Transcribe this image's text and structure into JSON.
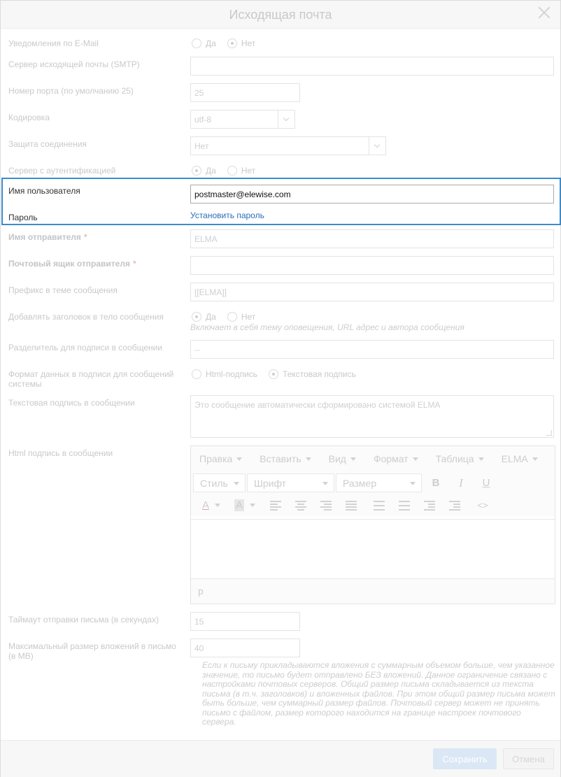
{
  "dialog": {
    "title": "Исходящая почта",
    "close_icon": "close-icon"
  },
  "fields": {
    "email_notifications": {
      "label": "Уведомления по E-Mail",
      "options": [
        "Да",
        "Нет"
      ],
      "selected": "Нет"
    },
    "smtp_server": {
      "label": "Сервер исходящей почты (SMTP)",
      "value": ""
    },
    "port": {
      "label": "Номер порта (по умолчанию 25)",
      "value": "25"
    },
    "encoding": {
      "label": "Кодировка",
      "value": "utf-8"
    },
    "security": {
      "label": "Защита соединения",
      "value": "Нет"
    },
    "auth_server": {
      "label": "Сервер с аутентификацией",
      "options": [
        "Да",
        "Нет"
      ],
      "selected": "Да"
    },
    "username": {
      "label": "Имя пользователя",
      "value": "postmaster@elewise.com"
    },
    "password": {
      "label": "Пароль",
      "link": "Установить пароль"
    },
    "sender_name": {
      "label": "Имя отправителя",
      "required": "*",
      "value": "ELMA"
    },
    "sender_mailbox": {
      "label": "Почтовый ящик отправителя",
      "required": "*",
      "value": ""
    },
    "subject_prefix": {
      "label": "Префикс в теме сообщения",
      "value": "[[ELMA]]"
    },
    "add_header": {
      "label": "Добавлять заголовок в тело сообщения",
      "options": [
        "Да",
        "Нет"
      ],
      "selected": "Да",
      "hint": "Включает в себя тему оповещения, URL адрес и автора сообщения"
    },
    "signature_separator": {
      "label": "Разделитель для подписи в сообщении",
      "value": "--"
    },
    "signature_format": {
      "label": "Формат данных в подписи для сообщений системы",
      "options": [
        "Html-подпись",
        "Текстовая подпись"
      ],
      "selected": "Текстовая подпись"
    },
    "text_signature": {
      "label": "Текстовая подпись в сообщении",
      "value": "Это сообщение автоматически сформировано системой ELMA"
    },
    "html_signature": {
      "label": "Html подпись в сообщении"
    },
    "send_timeout": {
      "label": "Таймаут отправки письма (в секундах)",
      "value": "15"
    },
    "max_attachment": {
      "label": "Максимальный размер вложений в письмо (в МВ)",
      "value": "40",
      "info": "Если к письму прикладываются вложения с суммарным объемом больше, чем указанное значение, то письмо будет отправлено БЕЗ вложений. Данное ограничение связано с настройками почтовых серверов. Общий размер письма складывается из текста письма (в т.ч. заголовков) и вложенных файлов. При этом общий размер письма может быть больше, чем суммарный размер файлов. Почтовый сервер может не принять письмо с файлом, размер которого находится на границе настроек почтового сервера."
    }
  },
  "editor": {
    "menus": [
      "Правка",
      "Вставить",
      "Вид",
      "Формат",
      "Таблица",
      "ELMA"
    ],
    "style": "Стиль",
    "font": "Шрифт",
    "size": "Размер",
    "bold": "B",
    "italic": "I",
    "underline": "U",
    "font_color": "A",
    "bg_color": "A",
    "code": "<>",
    "status_path": "p"
  },
  "footer": {
    "save": "Сохранить",
    "cancel": "Отмена"
  }
}
